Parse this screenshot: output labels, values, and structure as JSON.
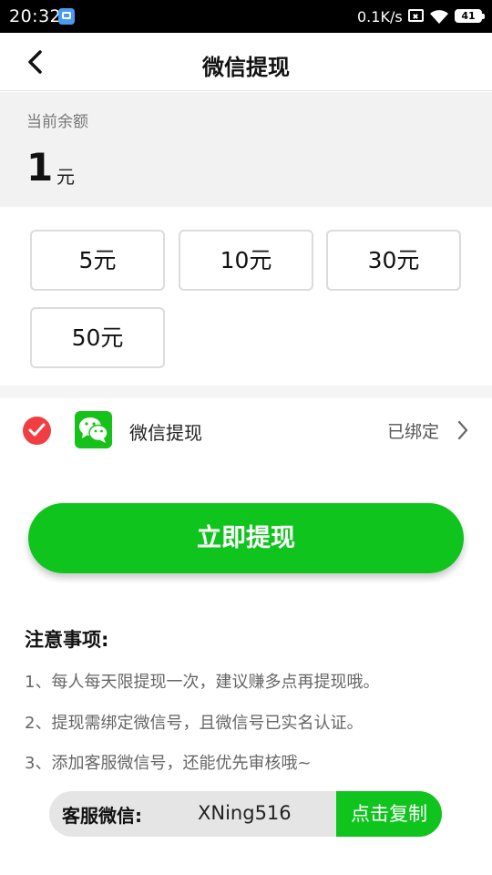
{
  "status_bar": {
    "time": "20:32",
    "network_speed": "0.1K/s",
    "battery": "41"
  },
  "header": {
    "title": "微信提现",
    "back_icon": "chevron-left-icon"
  },
  "balance": {
    "label": "当前余额",
    "amount": "1",
    "unit": "元"
  },
  "amount_options": [
    "5元",
    "10元",
    "30元",
    "50元"
  ],
  "withdraw_method": {
    "label": "微信提现",
    "status": "已绑定",
    "check_icon": "check-circle-icon",
    "app_icon": "wechat-icon"
  },
  "withdraw_button": "立即提现",
  "notes": {
    "title": "注意事项:",
    "items": [
      "1、每人每天限提现一次，建议赚多点再提现哦。",
      "2、提现需绑定微信号，且微信号已实名认证。",
      "3、添加客服微信号，还能优先审核哦~"
    ]
  },
  "contact": {
    "label": "客服微信:",
    "wechat_id": "XNing516",
    "copy_label": "点击复制"
  },
  "colors": {
    "accent_green": "#10c41e",
    "check_red": "#ef3f42",
    "balance_bg": "#f2f2f2"
  }
}
